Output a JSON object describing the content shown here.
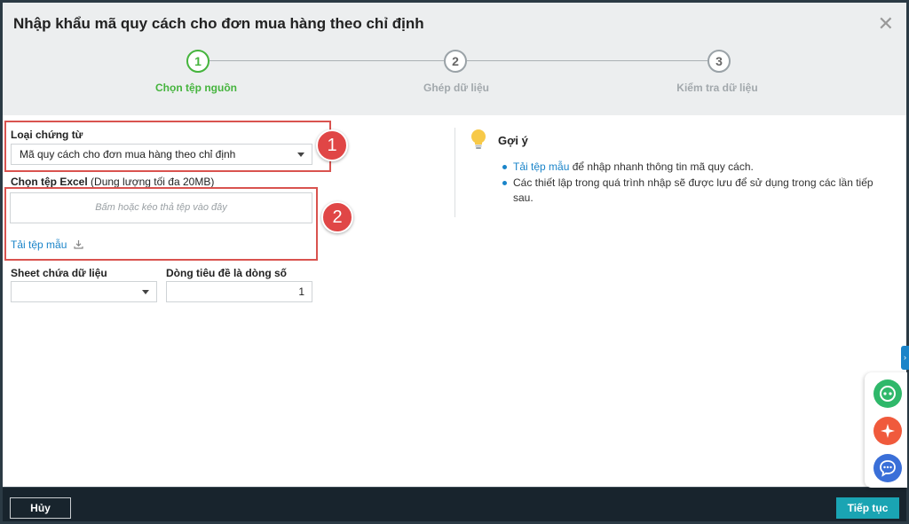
{
  "dialog": {
    "title": "Nhập khẩu mã quy cách cho đơn mua hàng theo chỉ định",
    "close_label": "✕"
  },
  "steps": [
    {
      "number": "1",
      "label": "Chọn tệp nguồn",
      "active": true
    },
    {
      "number": "2",
      "label": "Ghép dữ liệu",
      "active": false
    },
    {
      "number": "3",
      "label": "Kiểm tra dữ liệu",
      "active": false
    }
  ],
  "form": {
    "document_type_label": "Loại chứng từ",
    "document_type_value": "Mã quy cách cho đơn mua hàng theo chỉ định",
    "excel_label": "Chọn tệp Excel",
    "excel_hint": "(Dung lượng tối đa 20MB)",
    "dropzone_text": "Bấm hoặc kéo thả tệp vào đây",
    "template_link": "Tải tệp mẫu",
    "sheet_label": "Sheet chứa dữ liệu",
    "sheet_value": "",
    "header_row_label": "Dòng tiêu đề là dòng số",
    "header_row_value": "1"
  },
  "annotations": [
    "1",
    "2"
  ],
  "hint": {
    "title": "Gợi ý",
    "item1_link": "Tải tệp mẫu",
    "item1_text": " để nhập nhanh thông tin mã quy cách.",
    "item2_text": "Các thiết lập trong quá trình nhập sẽ được lưu để sử dụng trong các lần tiếp sau."
  },
  "side_tab_label": "›",
  "footer": {
    "cancel_label": "Hủy",
    "next_label": "Tiếp tục"
  },
  "colors": {
    "active_step": "#45b43d",
    "link": "#1a84c9",
    "primary_button": "#1aa4b3",
    "annotation_red": "#e04646"
  }
}
